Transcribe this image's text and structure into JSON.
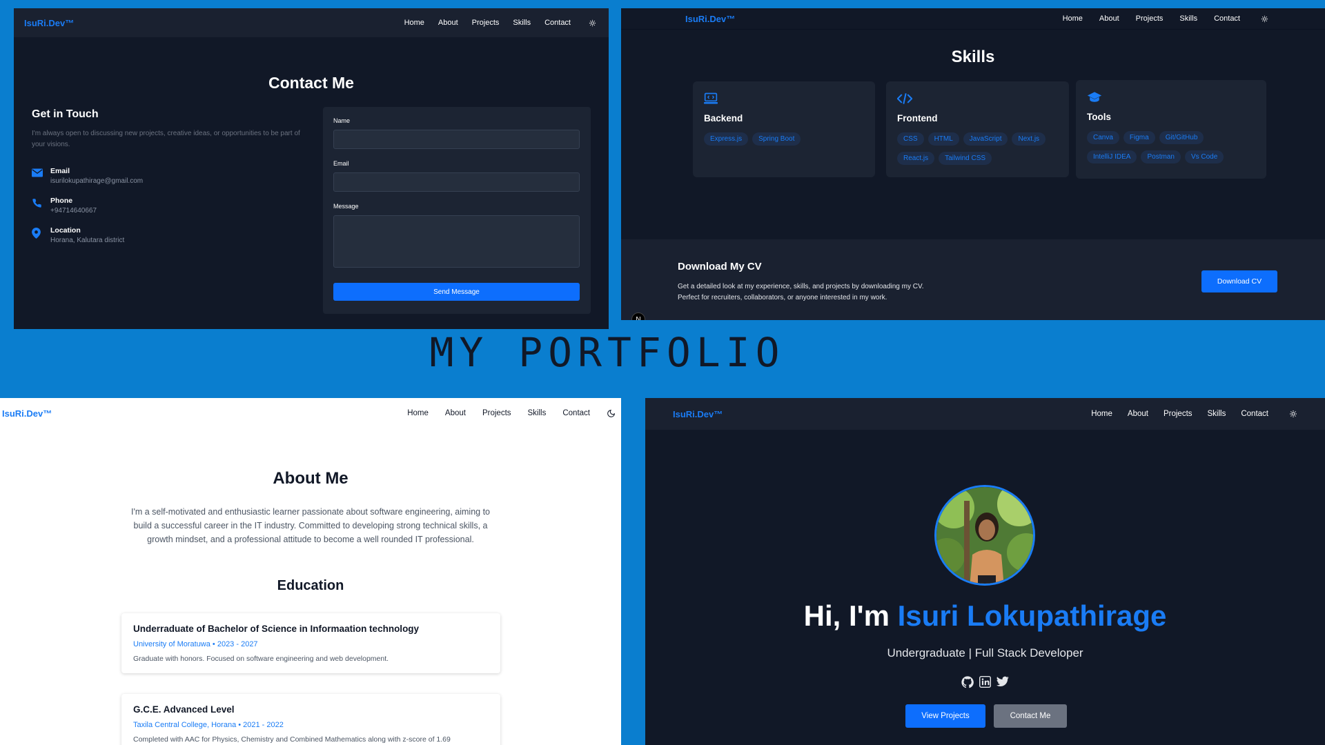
{
  "page_title": "MY PORTFOLIO",
  "colors": {
    "accent": "#1a7cf5",
    "background": "#0a7ecf",
    "dark": "#111827",
    "card": "#1c2433"
  },
  "contact": {
    "brand": "IsuRi.Dev™",
    "nav": [
      "Home",
      "About",
      "Projects",
      "Skills",
      "Contact"
    ],
    "theme_icon": "sun-icon",
    "title": "Contact Me",
    "get_in_touch": "Get in Touch",
    "intro": "I'm always open to discussing new projects, creative ideas, or opportunities to be part of your visions.",
    "items": [
      {
        "icon": "envelope-icon",
        "label": "Email",
        "value": "isurilokupathirage@gmail.com"
      },
      {
        "icon": "phone-icon",
        "label": "Phone",
        "value": "+94714640667"
      },
      {
        "icon": "location-pin-icon",
        "label": "Location",
        "value": "Horana, Kalutara district"
      }
    ],
    "form": {
      "name_label": "Name",
      "email_label": "Email",
      "message_label": "Message",
      "submit": "Send Message"
    }
  },
  "skills": {
    "brand": "IsuRi.Dev™",
    "nav": [
      "Home",
      "About",
      "Projects",
      "Skills",
      "Contact"
    ],
    "theme_icon": "sun-icon",
    "title": "Skills",
    "cards": [
      {
        "icon": "laptop-code-icon",
        "name": "Backend",
        "tags": [
          "Express.js",
          "Spring Boot"
        ]
      },
      {
        "icon": "code-icon",
        "name": "Frontend",
        "tags": [
          "CSS",
          "HTML",
          "JavaScript",
          "Next.js",
          "React.js",
          "Tailwind CSS"
        ]
      },
      {
        "icon": "graduation-cap-icon",
        "name": "Tools",
        "tags": [
          "Canva",
          "Figma",
          "Git/GitHub",
          "IntelliJ IDEA",
          "Postman",
          "Vs Code"
        ]
      }
    ],
    "cv": {
      "title": "Download My CV",
      "line1": "Get a detailed look at my experience, skills, and projects by downloading my CV.",
      "line2": "Perfect for recruiters, collaborators, or anyone interested in my work.",
      "button": "Download CV"
    },
    "badge": "N"
  },
  "about": {
    "brand": "IsuRi.Dev™",
    "nav": [
      "Home",
      "About",
      "Projects",
      "Skills",
      "Contact"
    ],
    "theme_icon": "moon-icon",
    "title": "About Me",
    "text": "I'm a self-motivated and enthusiastic learner passionate about software engineering, aiming to build a successful career in the IT industry. Committed to developing strong technical skills, a growth mindset, and a professional attitude to become a well rounded IT professional.",
    "education_title": "Education",
    "education": [
      {
        "degree": "Underraduate of Bachelor of Science in Informaation technology",
        "school": "University of Moratuwa • 2023 - 2027",
        "desc": "Graduate with honors. Focused on software engineering and web development."
      },
      {
        "degree": "G.C.E. Advanced Level",
        "school": "Taxila Central College, Horana • 2021 - 2022",
        "desc": "Completed with AAC for Physics, Chemistry and Combined Mathematics along with z-score of 1.69"
      }
    ]
  },
  "hero": {
    "brand": "IsuRi.Dev™",
    "nav": [
      "Home",
      "About",
      "Projects",
      "Skills",
      "Contact"
    ],
    "theme_icon": "sun-icon",
    "greeting": "Hi, I'm",
    "name": "Isuri Lokupathirage",
    "subtitle": "Undergraduate | Full Stack Developer",
    "socials": [
      "github-icon",
      "linkedin-icon",
      "twitter-icon"
    ],
    "primary_button": "View Projects",
    "secondary_button": "Contact Me"
  }
}
